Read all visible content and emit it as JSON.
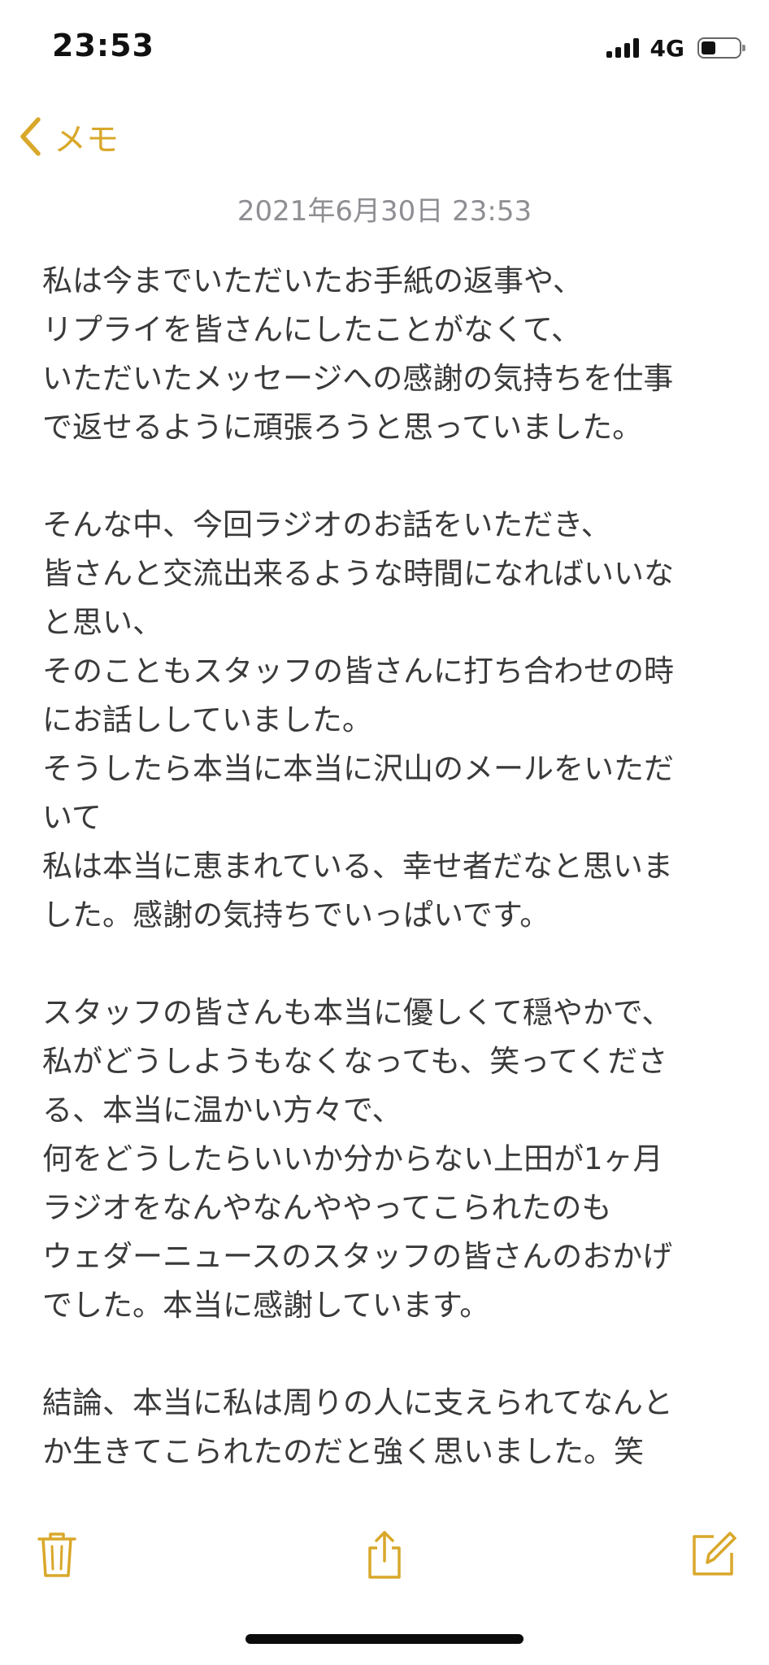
{
  "status_bar": {
    "time": "23:53",
    "network": "4G",
    "battery_level": 0.4
  },
  "nav": {
    "back_label": "メモ",
    "accent_color": "#d9a82a"
  },
  "note": {
    "date": "2021年6月30日 23:53",
    "lines": [
      "私は今までいただいたお手紙の返事や、",
      "リプライを皆さんにしたことがなくて、",
      "いただいたメッセージへの感謝の気持ちを仕事",
      "で返せるように頑張ろうと思っていました。",
      "",
      "そんな中、今回ラジオのお話をいただき、",
      "皆さんと交流出来るような時間になればいいな",
      "と思い、",
      "そのこともスタッフの皆さんに打ち合わせの時",
      "にお話ししていました。",
      "そうしたら本当に本当に沢山のメールをいただ",
      "いて",
      "私は本当に恵まれている、幸せ者だなと思いま",
      "した。感謝の気持ちでいっぱいです。",
      "",
      "スタッフの皆さんも本当に優しくて穏やかで、",
      "私がどうしようもなくなっても、笑ってくださ",
      "る、本当に温かい方々で、",
      "何をどうしたらいいか分からない上田が1ヶ月",
      "ラジオをなんやなんややってこられたのも",
      "ウェダーニュースのスタッフの皆さんのおかげ",
      "でした。本当に感謝しています。",
      "",
      "結論、本当に私は周りの人に支えられてなんと",
      "か生きてこられたのだと強く思いました。笑"
    ]
  },
  "toolbar": {
    "icons": [
      "trash-icon",
      "share-icon",
      "compose-icon"
    ]
  }
}
